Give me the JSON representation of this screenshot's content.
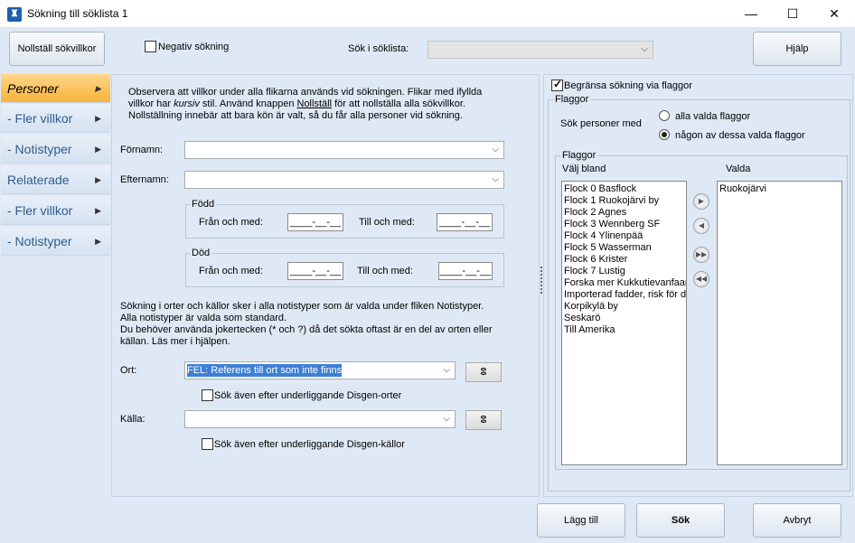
{
  "window": {
    "title": "Sökning till söklista 1",
    "app_icon": "app-icon",
    "minimize_glyph": "—",
    "maximize_glyph": "☐",
    "close_glyph": "✕"
  },
  "toolbar": {
    "reset_label": "Nollställ sökvillkor",
    "negative_search_label": "Negativ sökning",
    "search_in_list_label": "Sök i söklista:",
    "search_in_list_value": "",
    "help_label": "Hjälp"
  },
  "sidebar": {
    "items": [
      {
        "label": "Personer",
        "active": true
      },
      {
        "label": "- Fler villkor",
        "active": false
      },
      {
        "label": "- Notistyper",
        "active": false
      },
      {
        "label": "Relaterade",
        "active": false
      },
      {
        "label": "- Fler villkor",
        "active": false
      },
      {
        "label": "- Notistyper",
        "active": false
      }
    ]
  },
  "main": {
    "info_line1": "Observera att villkor under alla flikarna används vid sökningen. Flikar med ifyllda",
    "info_line2a": "villkor har ",
    "info_line2b": "kursiv",
    "info_line2c": " stil. Använd knappen ",
    "info_line2d": "Nollställ",
    "info_line2e": " för att nollställa alla sökvillkor.",
    "info_line3": "Nollställning innebär att bara kön är valt, så du får alla personer vid sökning.",
    "firstname_label": "Förnamn:",
    "firstname_value": "",
    "lastname_label": "Efternamn:",
    "lastname_value": "",
    "born_group": "Född",
    "died_group": "Död",
    "from_label": "Från och med:",
    "to_label": "Till och med:",
    "date_placeholder": "____-__-__",
    "places_line1": "Sökning i orter och källor sker i alla notistyper som är valda under fliken Notistyper.",
    "places_line2": "Alla notistyper är valda som standard.",
    "places_line3": "Du behöver använda jokertecken (* och ?) då det sökta oftast är en del av orten eller",
    "places_line4": "källan. Läs mer i hjälpen.",
    "place_label": "Ort:",
    "place_value": "FEL: Referens till ort som inte finns",
    "place_sub_label": "Sök även efter underliggande Disgen-orter",
    "source_label": "Källa:",
    "source_value": "",
    "source_sub_label": "Sök även efter underliggande Disgen-källor",
    "lamp_glyph": "💡"
  },
  "flags": {
    "limit_label": "Begränsa sökning via flaggor",
    "group_title": "Flaggor",
    "search_persons_with": "Sök personer med",
    "option_all": "alla valda flaggor",
    "option_any": "någon av dessa valda flaggor",
    "inner_group_title": "Flaggor",
    "choose_from_label": "Välj bland",
    "selected_label": "Valda",
    "available": [
      "Flock 0 Basflock",
      "Flock 1  Ruokojärvi by",
      "Flock 2 Agnes",
      "Flock 3 Wennberg SF",
      "Flock 4 Ylinenpää",
      "Flock 5 Wasserman",
      "Flock 6 Krister",
      "Flock 7 Lustig",
      "Forska mer Kukkutievanfaar",
      "Importerad fadder, risk för d",
      "Korpikylä by",
      "Seskarö",
      "Till Amerika"
    ],
    "selected": [
      "Ruokojärvi"
    ]
  },
  "bottom": {
    "add_label": "Lägg till",
    "search_label": "Sök",
    "cancel_label": "Avbryt"
  }
}
